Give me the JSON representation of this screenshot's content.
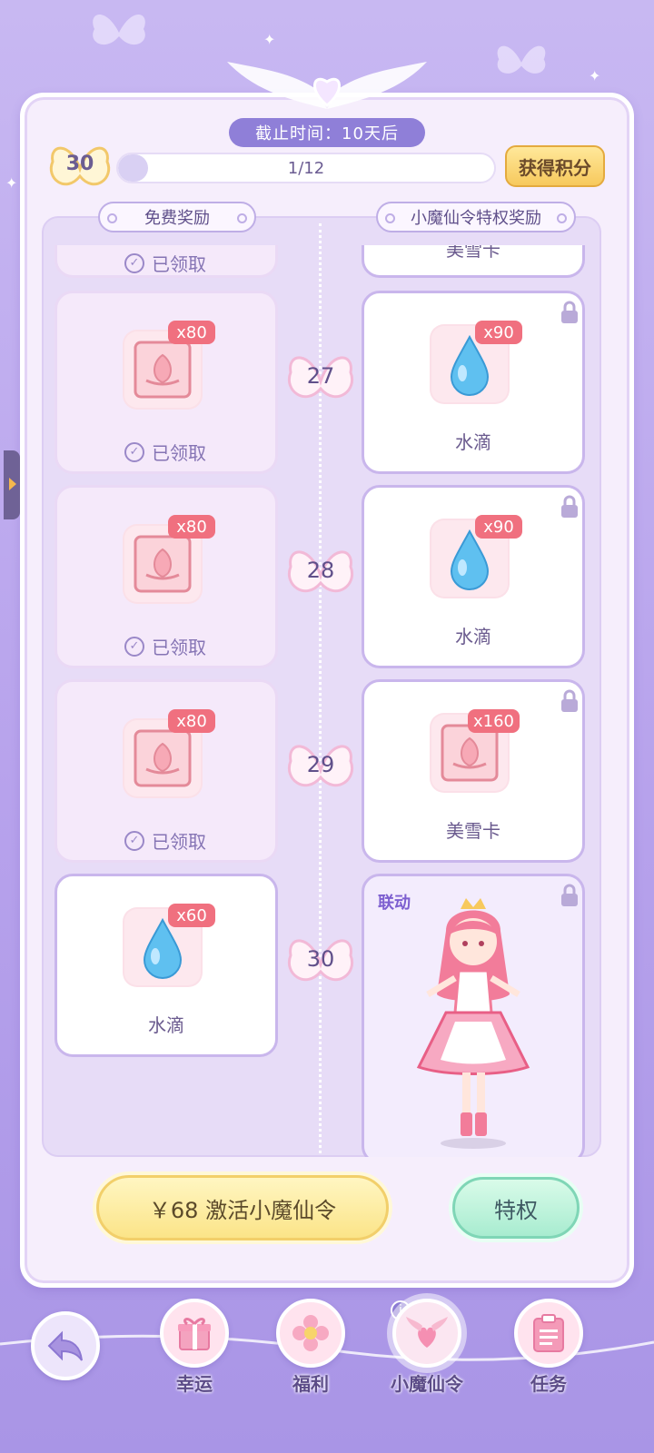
{
  "header": {
    "deadline": "截止时间：10天后",
    "level": "30",
    "progress_text": "1/12",
    "progress_fraction": 0.08,
    "earn_points_label": "获得积分"
  },
  "columns": {
    "free_title": "免费奖励",
    "vip_title": "小魔仙令特权奖励"
  },
  "rows": [
    {
      "level": "27",
      "free": {
        "qty": "x80",
        "item": "美雪卡",
        "status": "已领取"
      },
      "vip": {
        "qty": "x90",
        "item": "水滴"
      }
    },
    {
      "level": "28",
      "free": {
        "qty": "x80",
        "item": "美雪卡",
        "status": "已领取"
      },
      "vip": {
        "qty": "x90",
        "item": "水滴"
      }
    },
    {
      "level": "29",
      "free": {
        "qty": "x80",
        "item": "美雪卡",
        "status": "已领取"
      },
      "vip": {
        "qty": "x160",
        "item": "美雪卡"
      }
    },
    {
      "level": "30",
      "free": {
        "qty": "x60",
        "item": "水滴"
      },
      "vip": {
        "tag": "联动"
      }
    }
  ],
  "partial_top": {
    "free_status": "已领取",
    "vip_item": "美雪卡"
  },
  "actions": {
    "activate_label": "￥68 激活小魔仙令",
    "privilege_label": "特权"
  },
  "nav": {
    "items": [
      {
        "label": "幸运",
        "icon": "gift-icon"
      },
      {
        "label": "福利",
        "icon": "flower-icon"
      },
      {
        "label": "小魔仙令",
        "icon": "wing-heart-icon",
        "active": true
      },
      {
        "label": "任务",
        "icon": "clipboard-icon"
      }
    ],
    "back_icon": "back-arrow-icon"
  },
  "colors": {
    "accent": "#8f7fd8",
    "qty_badge": "#f0707f",
    "gold_button": "#f7c95d",
    "mint_button": "#a8ecd0"
  }
}
